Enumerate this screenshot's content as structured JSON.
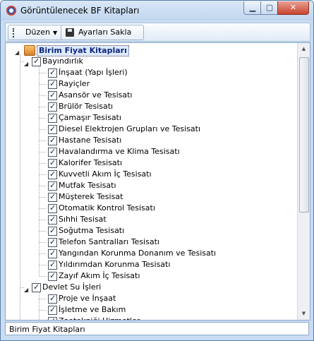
{
  "window": {
    "title": "Görüntülenecek BF Kitapları",
    "min_label": "▁",
    "max_label": "▢",
    "close_label": "✕"
  },
  "toolbar": {
    "duzen_label": "Düzen",
    "save_label": "Ayarları Sakla"
  },
  "tree": {
    "root": "Birim Fiyat Kitapları",
    "groups": [
      {
        "label": "Bayındırlık",
        "items": [
          "İnşaat (Yapı İşleri)",
          "Rayiçler",
          "Asansör ve Tesisatı",
          "Brülör Tesisatı",
          "Çamaşır Tesisatı",
          "Diesel Elektrojen Grupları ve Tesisatı",
          "Hastane Tesisatı",
          "Havalandırma ve Klima Tesisatı",
          "Kalorifer Tesisatı",
          "Kuvvetli Akım İç Tesisatı",
          "Mutfak Tesisatı",
          "Müşterek Tesisat",
          "Otomatik Kontrol Tesisatı",
          "Sıhhi Tesisat",
          "Soğutma Tesisatı",
          "Telefon Santralları Tesisatı",
          "Yangından Korunma Donanım ve Tesisatı",
          "Yıldırımdan Korunma Tesisatı",
          "Zayıf Akım İç Tesisatı"
        ]
      },
      {
        "label": "Devlet Su İşleri",
        "items": [
          "Proje ve İnşaat",
          "İşletme ve Bakım",
          "Zootekniği Hizmetler"
        ]
      }
    ]
  },
  "statusbar": {
    "text": "Birim Fiyat Kitapları"
  }
}
